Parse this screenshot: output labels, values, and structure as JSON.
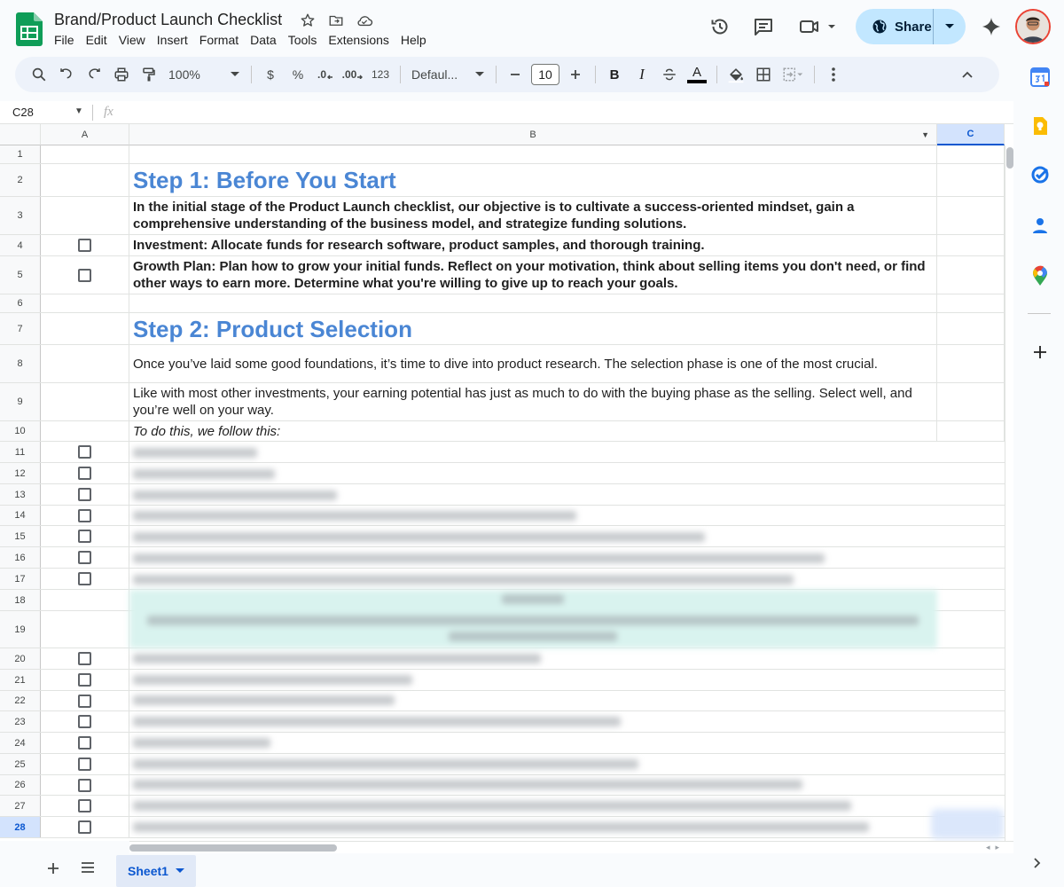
{
  "document": {
    "title": "Brand/Product Launch Checklist"
  },
  "menu": [
    "File",
    "Edit",
    "View",
    "Insert",
    "Format",
    "Data",
    "Tools",
    "Extensions",
    "Help"
  ],
  "share": {
    "label": "Share"
  },
  "toolbar": {
    "zoom": "100%",
    "currency": "$",
    "percent": "%",
    "decrease_decimal": ".0",
    "increase_decimal": ".00",
    "number_format": "123",
    "font": "Defaul...",
    "font_size": "10",
    "bold": "B",
    "italic": "I",
    "text_color_label": "A"
  },
  "formula_bar": {
    "name_box": "C28",
    "fx_label": "fx"
  },
  "columns": {
    "a": "A",
    "b": "B",
    "c": "C"
  },
  "rows": [
    {
      "n": "1",
      "text": ""
    },
    {
      "n": "2",
      "text": "Step 1: Before You Start"
    },
    {
      "n": "3",
      "text": "In the initial stage of the Product Launch checklist, our objective is to cultivate a success-oriented mindset, gain a comprehensive understanding of the business model, and strategize funding solutions."
    },
    {
      "n": "4",
      "text": "Investment: Allocate funds for research software, product samples, and thorough training."
    },
    {
      "n": "5",
      "text": "Growth Plan: Plan how to grow your initial funds. Reflect on your motivation, think about selling items you don't need, or find other ways to earn more. Determine what you're willing to give up to reach your goals."
    },
    {
      "n": "6",
      "text": ""
    },
    {
      "n": "7",
      "text": "Step 2: Product Selection"
    },
    {
      "n": "8",
      "text": "Once you’ve laid some good foundations, it’s time to dive into product research. The selection phase is one of the most crucial."
    },
    {
      "n": "9",
      "text": "Like with most other investments, your earning potential has just as much to do with the buying phase as the selling. Select well, and you’re well on your way."
    },
    {
      "n": "10",
      "text": "To do this, we follow this:"
    },
    {
      "n": "11"
    },
    {
      "n": "12"
    },
    {
      "n": "13"
    },
    {
      "n": "14"
    },
    {
      "n": "15"
    },
    {
      "n": "16"
    },
    {
      "n": "17"
    },
    {
      "n": "18"
    },
    {
      "n": "19"
    },
    {
      "n": "20"
    },
    {
      "n": "21"
    },
    {
      "n": "22"
    },
    {
      "n": "23"
    },
    {
      "n": "24"
    },
    {
      "n": "25"
    },
    {
      "n": "26"
    },
    {
      "n": "27"
    },
    {
      "n": "28"
    }
  ],
  "sheet_tab": {
    "label": "Sheet1"
  },
  "colors": {
    "heading_blue": "#4a86d4",
    "share_bg": "#c2e7ff",
    "selected_header": "#d3e3fd",
    "teal_fill": "#d9f3ef"
  },
  "icons": [
    "sheets-logo-icon",
    "star-icon",
    "move-folder-icon",
    "cloud-status-icon",
    "history-icon",
    "comment-icon",
    "meet-icon",
    "globe-icon",
    "gemini-icon",
    "search-icon",
    "undo-icon",
    "redo-icon",
    "print-icon",
    "paint-format-icon",
    "calendar-icon",
    "keep-icon",
    "tasks-icon",
    "contacts-icon",
    "maps-icon",
    "add-icon"
  ]
}
